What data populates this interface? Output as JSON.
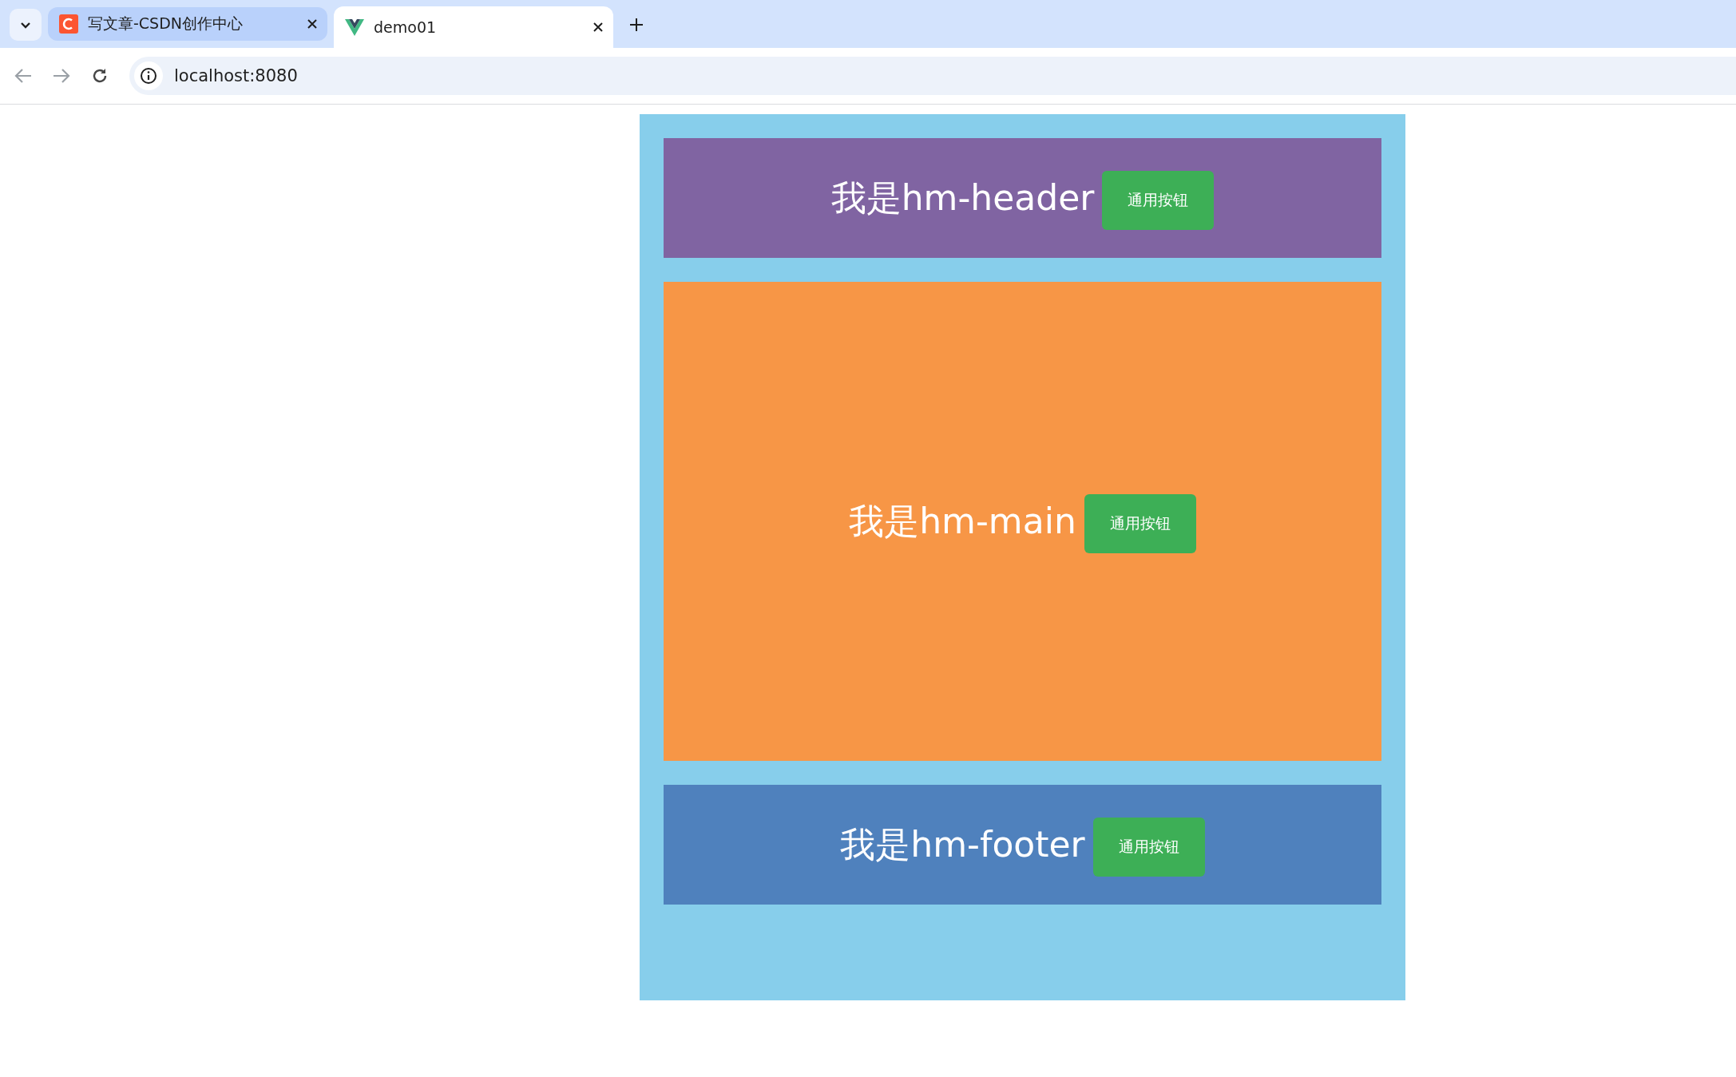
{
  "browser": {
    "tabs": [
      {
        "title": "写文章-CSDN创作中心",
        "kind": "csdn",
        "selected": false
      },
      {
        "title": "demo01",
        "kind": "vue",
        "selected": true
      }
    ],
    "address": "localhost:8080"
  },
  "sections": [
    {
      "title": "我是hm-header",
      "button": "通用按钮",
      "kind": "header",
      "color": "#8064a2"
    },
    {
      "title": "我是hm-main",
      "button": "通用按钮",
      "kind": "main",
      "color": "#f79646"
    },
    {
      "title": "我是hm-footer",
      "button": "通用按钮",
      "kind": "footer",
      "color": "#4f81bd"
    }
  ]
}
